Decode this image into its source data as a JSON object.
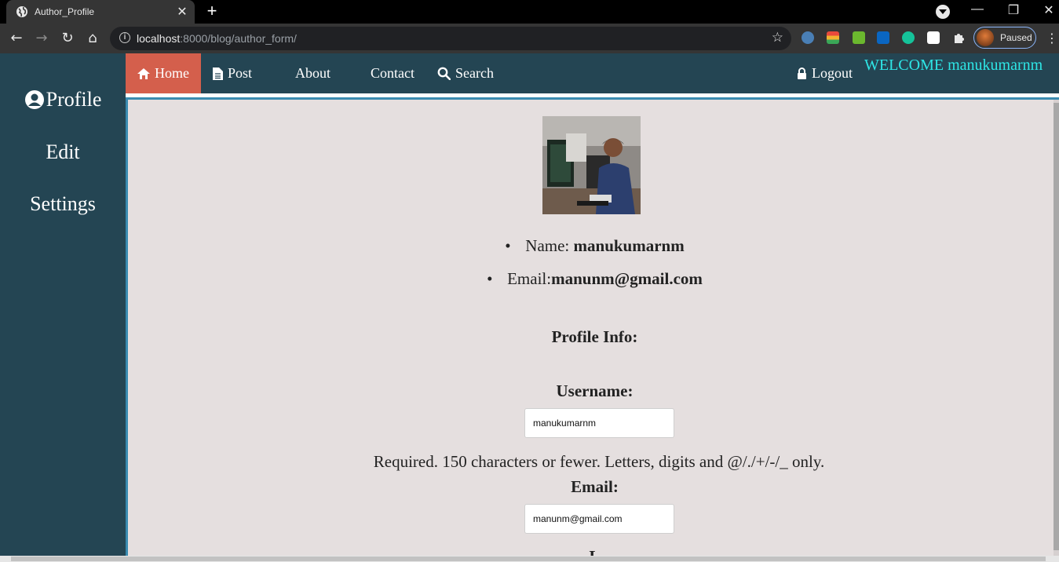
{
  "browser": {
    "tab_title": "Author_Profile",
    "new_tab_label": "+",
    "url_host": "localhost",
    "url_rest": ":8000/blog/author_form/",
    "profile_chip_label": "Paused"
  },
  "sidebar": {
    "items": [
      {
        "label": "Profile",
        "icon": "user-circle-icon"
      },
      {
        "label": "Edit"
      },
      {
        "label": "Settings"
      }
    ]
  },
  "nav": {
    "links": [
      {
        "label": "Home",
        "icon": "home-icon"
      },
      {
        "label": "Post",
        "icon": "file-icon"
      },
      {
        "label": "About"
      },
      {
        "label": "Contact"
      },
      {
        "label": "Search",
        "icon": "search-icon"
      },
      {
        "label": "Logout",
        "icon": "lock-icon"
      }
    ],
    "welcome": "WELCOME manukumarnm"
  },
  "profile": {
    "name_label": "Name: ",
    "name_value": "manukumarnm",
    "email_label": "Email:",
    "email_value": "manunm@gmail.com",
    "section_heading": "Profile Info:",
    "username_label": "Username:",
    "username_value": "manukumarnm",
    "username_help": "Required. 150 characters or fewer. Letters, digits and @/./+/-/_ only.",
    "email_field_label": "Email:",
    "email_field_value": "manunm@gmail.com",
    "next_label_cut": "L"
  },
  "colors": {
    "sidebar_bg": "#244553",
    "home_active": "#d45f4c",
    "content_bg": "#e5dfdf",
    "welcome": "#2ee6e6"
  }
}
